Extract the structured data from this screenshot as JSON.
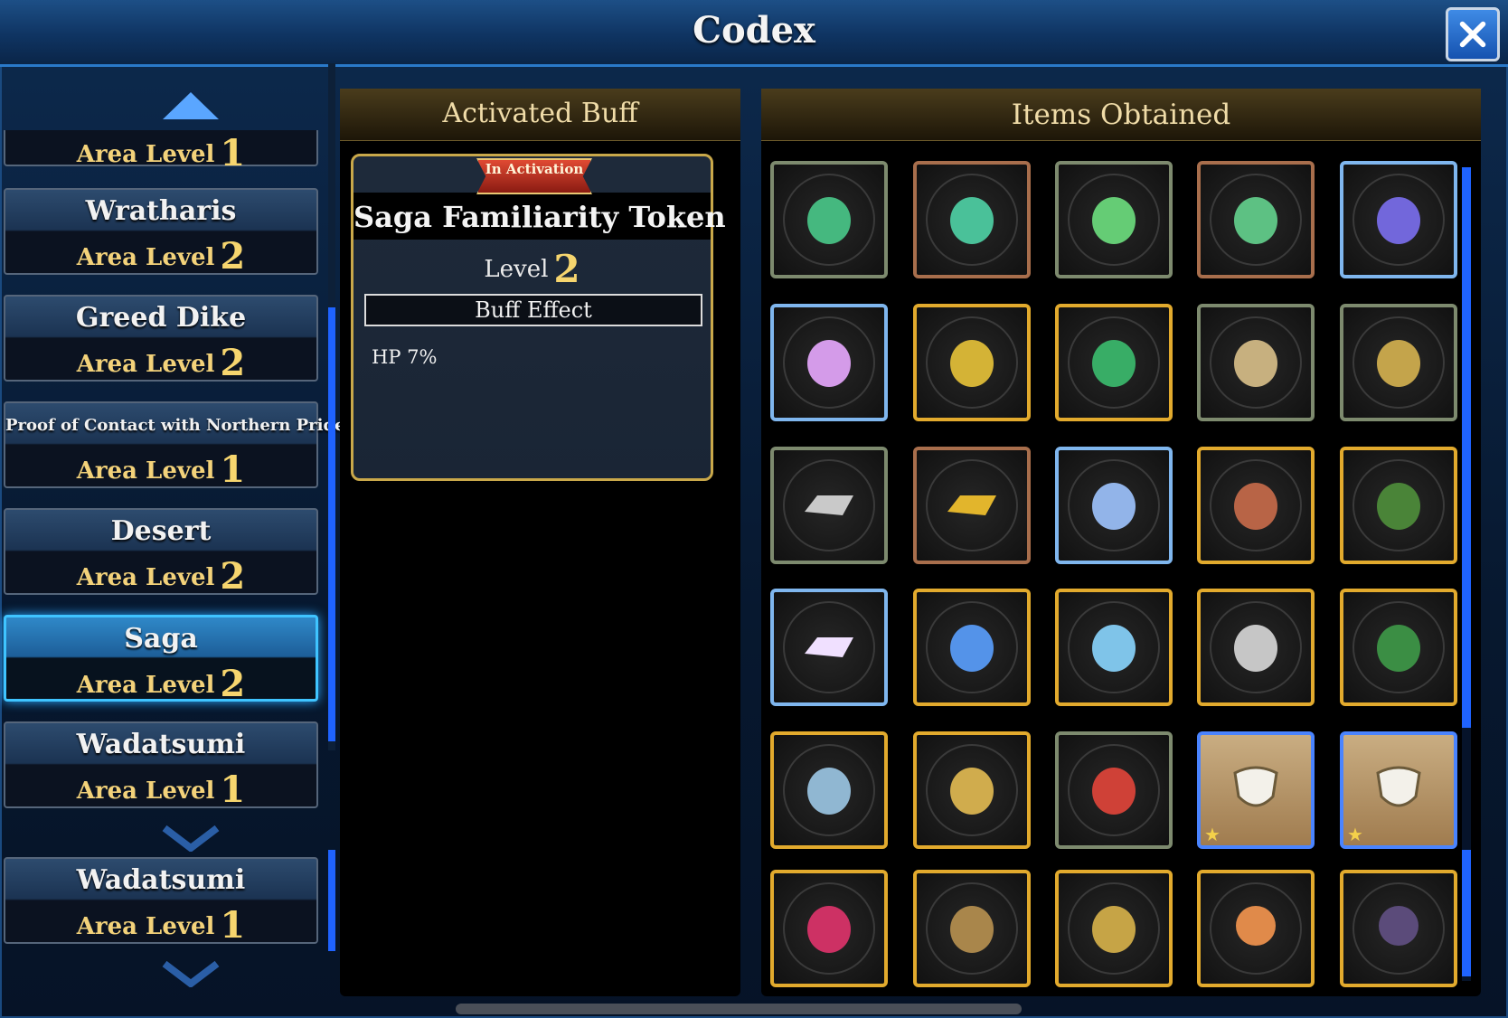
{
  "window": {
    "title": "Codex",
    "close_icon": "close-x-icon"
  },
  "areas": [
    {
      "name": "",
      "level_label": "Area Level",
      "level": "1"
    },
    {
      "name": "Wratharis",
      "level_label": "Area Level",
      "level": "2"
    },
    {
      "name": "Greed Dike",
      "level_label": "Area Level",
      "level": "2"
    },
    {
      "name": "Proof of Contact with Northern Pride",
      "level_label": "Area Level",
      "level": "1"
    },
    {
      "name": "Desert",
      "level_label": "Area Level",
      "level": "2"
    },
    {
      "name": "Saga",
      "level_label": "Area Level",
      "level": "2"
    },
    {
      "name": "Wadatsumi",
      "level_label": "Area Level",
      "level": "1"
    },
    {
      "name": "Wadatsumi",
      "level_label": "Area Level",
      "level": "1"
    }
  ],
  "buff": {
    "header": "Activated Buff",
    "badge": "In Activation",
    "name": "Saga Familiarity Token",
    "level_label": "Level",
    "level": "2",
    "effect_header": "Buff Effect",
    "effect": "HP 7%"
  },
  "items": {
    "header": "Items Obtained",
    "slots": [
      {
        "icon": "green-jar-icon",
        "frame": "green"
      },
      {
        "icon": "green-spirit-icon",
        "frame": "bronze"
      },
      {
        "icon": "green-robot-icon",
        "frame": "green"
      },
      {
        "icon": "green-armor-icon",
        "frame": "bronze"
      },
      {
        "icon": "purple-creature-icon",
        "frame": "blue"
      },
      {
        "icon": "rainbow-jar-icon",
        "frame": "blue"
      },
      {
        "icon": "ribbons-icon",
        "frame": "gold"
      },
      {
        "icon": "green-orb-icon",
        "frame": "gold"
      },
      {
        "icon": "feather-necklace-icon",
        "frame": "green"
      },
      {
        "icon": "maracas-icon",
        "frame": "green"
      },
      {
        "icon": "silver-bar-icon",
        "frame": "green"
      },
      {
        "icon": "gold-bar-icon",
        "frame": "bronze"
      },
      {
        "icon": "crystal-apple-icon",
        "frame": "blue"
      },
      {
        "icon": "mask-icon",
        "frame": "gold"
      },
      {
        "icon": "leaf-cape-icon",
        "frame": "gold"
      },
      {
        "icon": "rainbow-bar-icon",
        "frame": "blue"
      },
      {
        "icon": "scroll-crystal-icon",
        "frame": "gold"
      },
      {
        "icon": "crystal-shard-icon",
        "frame": "gold"
      },
      {
        "icon": "wolf-fur-icon",
        "frame": "gold"
      },
      {
        "icon": "bracer-icon",
        "frame": "gold"
      },
      {
        "icon": "silver-shield-icon",
        "frame": "gold"
      },
      {
        "icon": "gold-shield-icon",
        "frame": "gold"
      },
      {
        "icon": "red-crystal-icon",
        "frame": "green"
      },
      {
        "icon": "character-card-icon",
        "frame": "square"
      },
      {
        "icon": "character-card-icon",
        "frame": "square"
      },
      {
        "icon": "red-shards-icon",
        "frame": "gold"
      },
      {
        "icon": "bow-icon",
        "frame": "gold"
      },
      {
        "icon": "hammer-icon",
        "frame": "gold"
      },
      {
        "icon": "hero-portrait-icon",
        "frame": "gold"
      },
      {
        "icon": "hero-portrait-icon",
        "frame": "gold"
      }
    ]
  },
  "colors": {
    "accent_blue": "#1f63ff",
    "gold": "#e2aa2d",
    "level_gold": "#f6d56e"
  }
}
